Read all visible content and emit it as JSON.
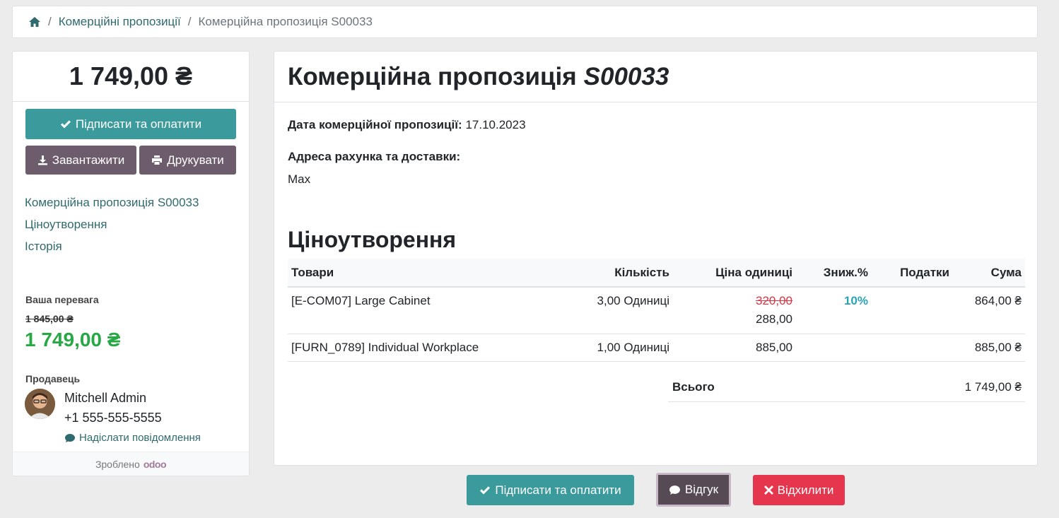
{
  "breadcrumb": {
    "home_icon": "home-icon",
    "link_label": "Комерційні пропозиції",
    "current_label": "Комерційна пропозиція S00033"
  },
  "sidebar": {
    "total": "1 749,00 ₴",
    "sign_pay_label": "Підписати та оплатити",
    "download_label": "Завантажити",
    "print_label": "Друкувати",
    "nav": [
      "Комерційна пропозиція S00033",
      "Ціноутворення",
      "Історія"
    ],
    "advantage_label": "Ваша перевага",
    "old_price": "1 845,00 ₴",
    "new_price": "1 749,00 ₴",
    "salesperson_label": "Продавець",
    "salesperson_name": "Mitchell Admin",
    "salesperson_phone": "+1 555-555-5555",
    "send_message_label": "Надіслати повідомлення",
    "made_by_label": "Зроблено",
    "made_by_brand": "odoo"
  },
  "main": {
    "title_prefix": "Комерційна пропозиція",
    "title_number": "S00033",
    "date_label": "Дата комерційної пропозиції:",
    "date_value": "17.10.2023",
    "address_label": "Адреса рахунка та доставки:",
    "address_value": "Max",
    "pricing_title": "Ціноутворення",
    "columns": [
      "Товари",
      "Кількість",
      "Ціна одиниці",
      "Зниж.%",
      "Податки",
      "Сума"
    ],
    "rows": [
      {
        "product": "[E-COM07] Large Cabinet",
        "qty": "3,00 Одиниці",
        "old_price": "320,00",
        "price": "288,00",
        "discount": "10%",
        "tax": "",
        "amount": "864,00 ₴"
      },
      {
        "product": "[FURN_0789] Individual Workplace",
        "qty": "1,00 Одиниці",
        "old_price": "",
        "price": "885,00",
        "discount": "",
        "tax": "",
        "amount": "885,00 ₴"
      }
    ],
    "total_label": "Всього",
    "total_value": "1 749,00 ₴"
  },
  "actions": {
    "sign_pay_label": "Підписати та оплатити",
    "feedback_label": "Відгук",
    "reject_label": "Відхилити"
  },
  "colors": {
    "primary": "#3b9a9c",
    "secondary": "#6d5d6c",
    "danger": "#e5364e",
    "success": "#28a745"
  }
}
